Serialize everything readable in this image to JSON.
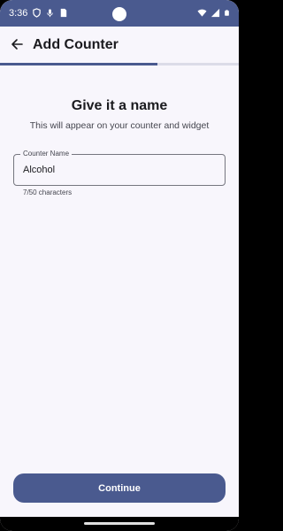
{
  "status_bar": {
    "time": "3:36",
    "left_icons": [
      "shield-icon",
      "mic-icon",
      "sim-card-icon"
    ],
    "right_icons": [
      "wifi-icon",
      "signal-icon",
      "battery-icon"
    ]
  },
  "app_bar": {
    "title": "Add Counter",
    "back_icon": "arrow-left-icon"
  },
  "progress": {
    "value": 0.66
  },
  "step": {
    "heading": "Give it a name",
    "subheading": "This will appear on your counter and widget"
  },
  "counter_name_field": {
    "label": "Counter Name",
    "value": "Alcohol",
    "helper": "7/50 characters"
  },
  "continue_button": {
    "label": "Continue"
  },
  "colors": {
    "primary": "#4a5a8f",
    "background": "#f8f6fc",
    "on_surface": "#1b1b1f"
  }
}
